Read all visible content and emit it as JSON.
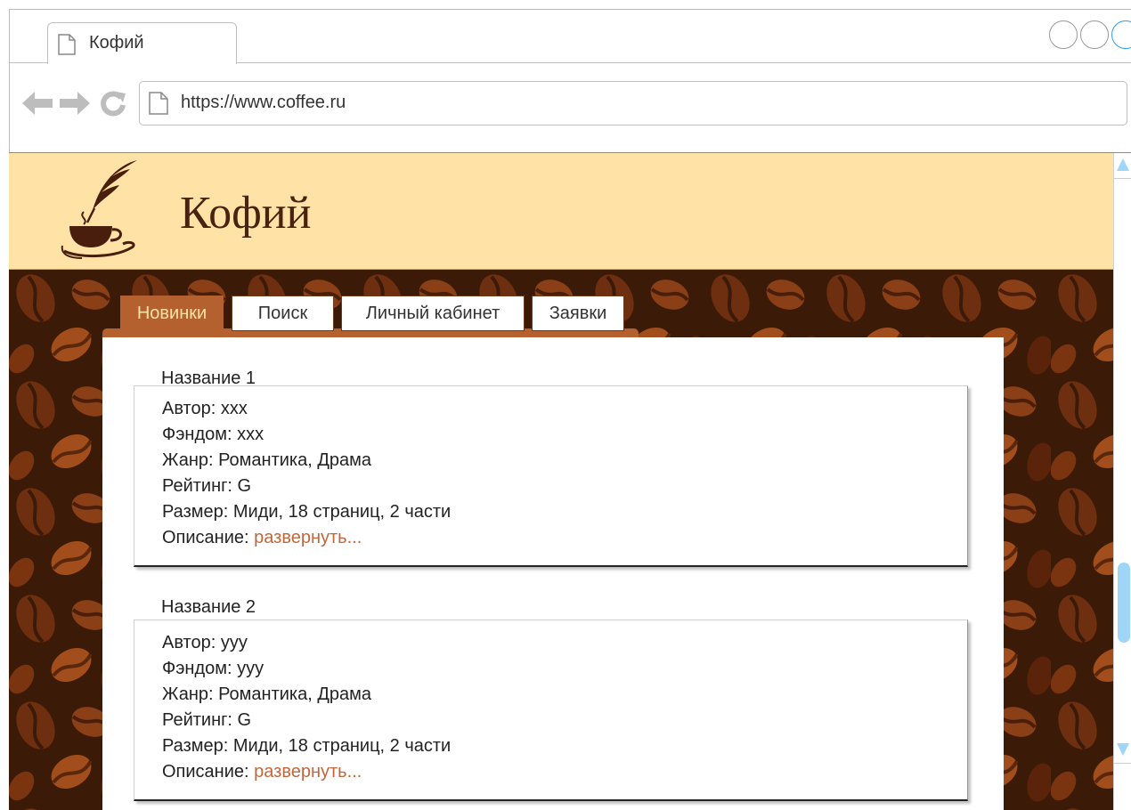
{
  "browser": {
    "tab_title": "Кофий",
    "url": "https://www.coffee.ru",
    "icons": [
      "page-icon",
      "back-arrow-icon",
      "forward-arrow-icon",
      "reload-icon"
    ]
  },
  "site": {
    "title": "Кофий",
    "logo_icon": "coffee-cup-quill-logo"
  },
  "nav": {
    "tabs": [
      {
        "label": "Новинки",
        "active": true
      },
      {
        "label": "Поиск",
        "active": false
      },
      {
        "label": "Личный кабинет",
        "active": false
      },
      {
        "label": "Заявки",
        "active": false
      }
    ]
  },
  "items": [
    {
      "title": "Название 1",
      "author": "Автор: xxx",
      "fandom": "Фэндом: xxx",
      "genre": "Жанр: Романтика, Драма",
      "rating": "Рейтинг: G",
      "size": "Размер: Миди, 18 страниц, 2 части",
      "description_label": "Описание: ",
      "description_link": "развернуть..."
    },
    {
      "title": "Название 2",
      "author": "Автор: yyy",
      "fandom": "Фэндом: yyy",
      "genre": "Жанр: Романтика, Драма",
      "rating": "Рейтинг: G",
      "size": "Размер: Миди, 18 страниц, 2 части",
      "description_label": "Описание: ",
      "description_link": "развернуть..."
    }
  ],
  "colors": {
    "header_bg": "#ffe3a6",
    "accent": "#b4602f",
    "link": "#c2663a",
    "bean_bg": "#3b1a07",
    "scroll_thumb": "#9fd6f7"
  }
}
